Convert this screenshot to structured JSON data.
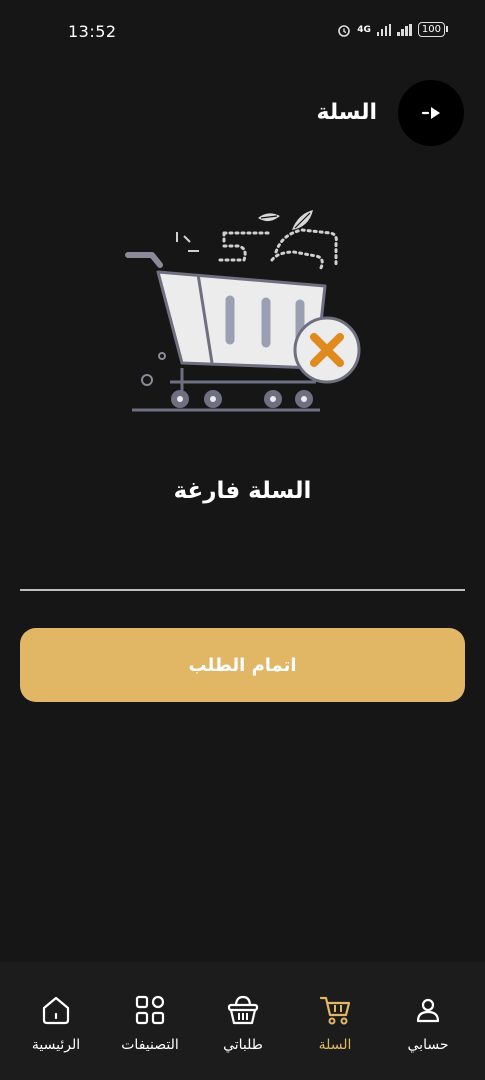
{
  "status_bar": {
    "time": "13:52",
    "network": "4G",
    "battery": "100"
  },
  "header": {
    "title": "السلة"
  },
  "empty_state": {
    "message": "السلة فارغة"
  },
  "checkout": {
    "label": "اتمام الطلب"
  },
  "bottom_nav": {
    "items": [
      {
        "label": "حسابي",
        "icon": "user-icon",
        "active": false
      },
      {
        "label": "السلة",
        "icon": "cart-icon",
        "active": true
      },
      {
        "label": "طلباتي",
        "icon": "basket-icon",
        "active": false
      },
      {
        "label": "التصنيفات",
        "icon": "grid-icon",
        "active": false
      },
      {
        "label": "الرئيسية",
        "icon": "home-icon",
        "active": false
      }
    ]
  },
  "colors": {
    "accent": "#e1b766",
    "background": "#161616",
    "nav_background": "#1c1c1c",
    "error": "#e08a1e"
  }
}
